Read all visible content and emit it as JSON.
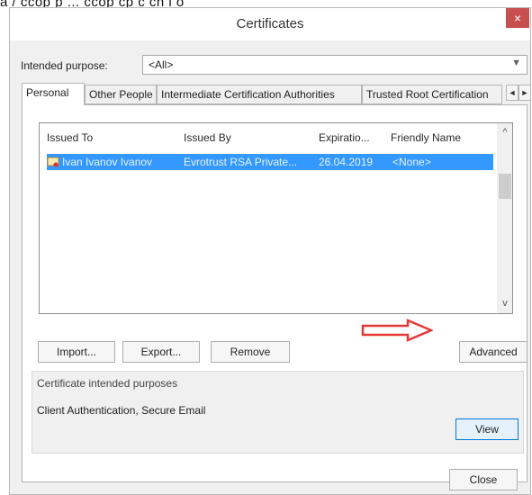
{
  "window": {
    "title": "Certificates",
    "close_glyph": "×"
  },
  "crop_text": "a   /   ccop   p   ...   ccop   cp   c   cn   i   o",
  "purpose": {
    "label": "Intended purpose:",
    "value": "<All>"
  },
  "tabs": [
    {
      "label": "Personal"
    },
    {
      "label": "Other People"
    },
    {
      "label": "Intermediate Certification Authorities"
    },
    {
      "label": "Trusted Root Certification"
    }
  ],
  "tab_arrows": {
    "left": "◄",
    "right": "►"
  },
  "list": {
    "headers": [
      "Issued To",
      "Issued By",
      "Expiratio...",
      "Friendly Name"
    ],
    "rows": [
      {
        "issued_to": "Ivan Ivanov Ivanov",
        "issued_by": "Evrotrust RSA Private...",
        "expiration": "26.04.2019",
        "friendly_name": "<None>"
      }
    ]
  },
  "scroll": {
    "up": "^",
    "down": "v"
  },
  "buttons": {
    "import": "Import...",
    "export": "Export...",
    "remove": "Remove",
    "advanced": "Advanced",
    "view": "View",
    "close": "Close"
  },
  "purposes": {
    "title": "Certificate intended purposes",
    "text": "Client Authentication, Secure Email"
  },
  "colors": {
    "selection": "#3399ff",
    "close_button": "#c7504f",
    "annotation_arrow": "#e53935"
  }
}
